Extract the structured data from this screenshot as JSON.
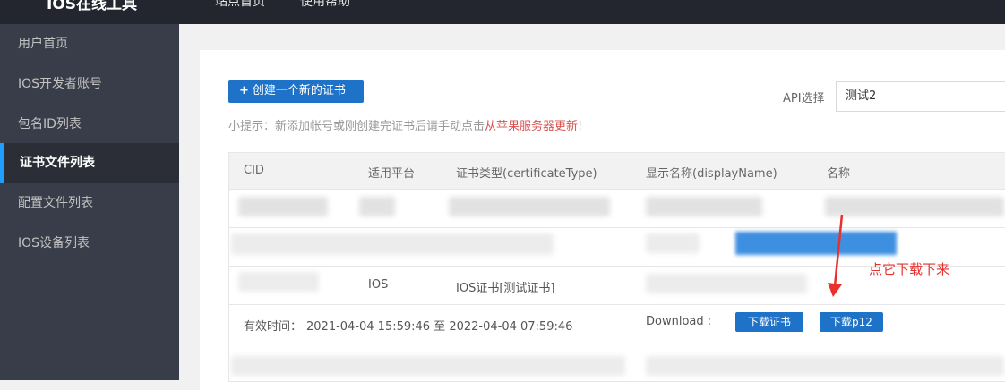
{
  "topbar": {
    "title": "IOS在线工具",
    "nav": [
      "站点首页",
      "使用帮助"
    ]
  },
  "sidebar": {
    "items": [
      {
        "label": "用户首页"
      },
      {
        "label": "IOS开发者账号"
      },
      {
        "label": "包名ID列表"
      },
      {
        "label": "证书文件列表",
        "active": true
      },
      {
        "label": "配置文件列表"
      },
      {
        "label": "IOS设备列表"
      }
    ]
  },
  "toolbar": {
    "create_label": "创建一个新的证书",
    "create_icon": "plus-icon"
  },
  "api": {
    "label": "API选择",
    "value": "测试2"
  },
  "tip": {
    "prefix": "小提示：新添加帐号或刚创建完证书后请手动点击",
    "link": "从苹果服务器更新",
    "suffix": "!"
  },
  "table": {
    "columns": [
      "CID",
      "适用平台",
      "证书类型(certificateType)",
      "显示名称(displayName)",
      "名称"
    ],
    "row3": {
      "platform": "IOS",
      "type": "IOS证书[测试证书]"
    },
    "validity": {
      "label": "有效时间：",
      "range": "2021-04-04 15:59:46 至 2022-04-04 07:59:46"
    },
    "download": {
      "label": "Download :",
      "cert_button": "下载证书",
      "p12_button": "下载p12"
    }
  },
  "annotation": {
    "text": "点它下载下来",
    "color": "#e8302c"
  },
  "colors": {
    "accent": "#1e72c8",
    "sidebar": "#393d49",
    "topbar": "#23262e",
    "link_red": "#d9534f"
  }
}
